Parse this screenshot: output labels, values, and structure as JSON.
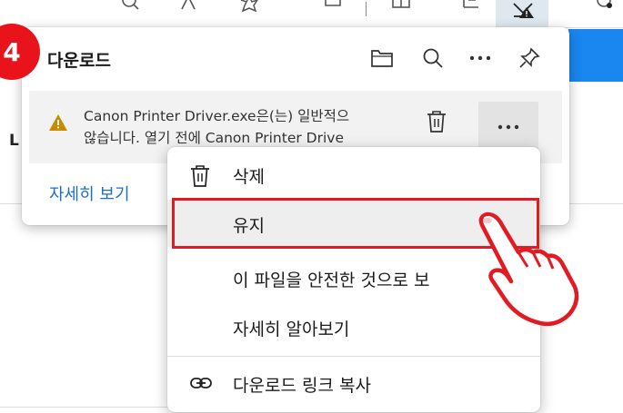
{
  "step_badge": "4",
  "flyout": {
    "title": "다운로드",
    "header_icons": [
      "folder-icon",
      "search-icon",
      "more-icon",
      "pin-icon"
    ],
    "item": {
      "line1": "Canon Printer Driver.exe은(는) 일반적으",
      "line2": "않습니다. 열기 전에 Canon Printer Drive"
    },
    "see_more": "자세히 보기"
  },
  "page": {
    "left_letter": "L"
  },
  "context_menu": {
    "items": [
      {
        "label": "삭제",
        "icon": "trash-icon"
      },
      {
        "label": "유지",
        "icon": ""
      },
      {
        "label": "이 파일을 안전한 것으로 보",
        "icon": ""
      },
      {
        "label": "자세히 알아보기",
        "icon": ""
      },
      {
        "label": "다운로드 링크 복사",
        "icon": "link-icon"
      }
    ],
    "highlighted_index": 1
  },
  "colors": {
    "badge": "#e9141b",
    "highlight_border": "#e21b23",
    "link": "#1a6fc4",
    "page_accent": "#1a86f0",
    "warning": "#c88a00"
  }
}
